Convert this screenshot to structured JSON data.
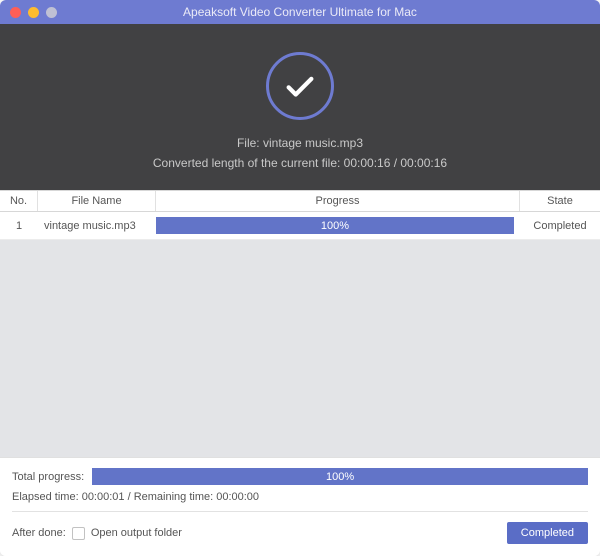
{
  "window": {
    "title": "Apeaksoft Video Converter Ultimate for Mac"
  },
  "status": {
    "file_label": "File: vintage music.mp3",
    "converted_label": "Converted length of the current file: 00:00:16 / 00:00:16"
  },
  "columns": {
    "no": "No.",
    "filename": "File Name",
    "progress": "Progress",
    "state": "State"
  },
  "rows": [
    {
      "no": "1",
      "filename": "vintage music.mp3",
      "progress_pct": "100%",
      "state": "Completed"
    }
  ],
  "total_progress": {
    "label": "Total progress:",
    "pct": "100%"
  },
  "time": {
    "text": "Elapsed time: 00:00:01 / Remaining time: 00:00:00"
  },
  "after_done": {
    "label": "After done:",
    "checkbox_label": "Open output folder"
  },
  "action_button": {
    "label": "Completed"
  }
}
